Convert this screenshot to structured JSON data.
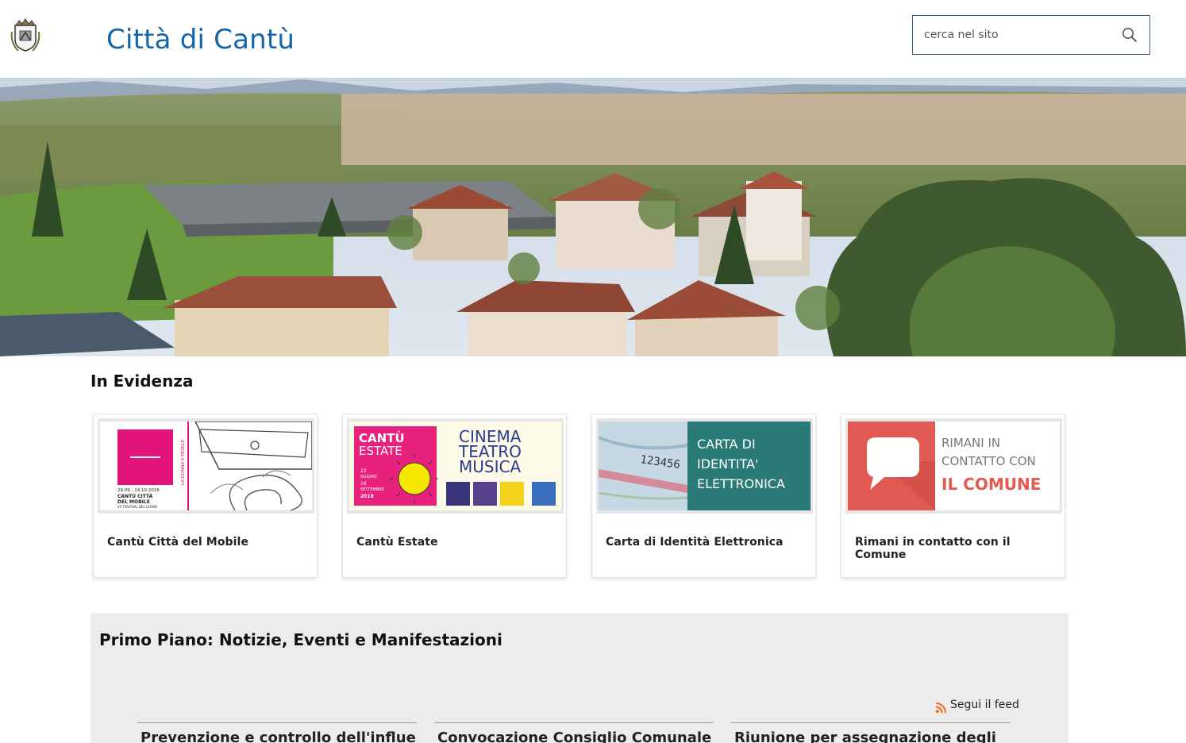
{
  "header": {
    "site_title": "Città di Cantù",
    "crest_icon": "municipal-crest-icon",
    "search": {
      "placeholder": "cerca nel sito",
      "value": "",
      "icon": "search-icon"
    }
  },
  "hero": {
    "image": "aerial-town-panorama"
  },
  "evidenza": {
    "title": "In Evidenza",
    "cards": [
      {
        "title": "Cantù Città del Mobile",
        "image": {
          "vertical_text": "LA DONNA E MOBILE",
          "dates": "29.09 - 14.10.2018",
          "line1": "CANTÙ CITTÀ",
          "line2": "DEL MOBILE",
          "line3": "VI° FESTIVAL DEL LEGNO"
        }
      },
      {
        "title": "Cantù Estate",
        "image": {
          "brand1": "CANTÙ",
          "brand2": "ESTATE",
          "date1": "22",
          "date2": "GIUGNO",
          "date3": "16",
          "date4": "SETTEMBRE",
          "year": "2018",
          "w1": "CINEMA",
          "w2": "TEATRO",
          "w3": "MUSICA"
        }
      },
      {
        "title": "Carta di Identità Elettronica",
        "image": {
          "l1": "CARTA DI",
          "l2": "IDENTITA'",
          "l3": "ELETTRONICA",
          "digits": "123456"
        }
      },
      {
        "title": "Rimani in contatto con il Comune",
        "image": {
          "l1": "RIMANI IN",
          "l2": "CONTATTO CON",
          "l3": "IL COMUNE",
          "icon": "speech-bubble-icon"
        }
      }
    ]
  },
  "primo_piano": {
    "title": "Primo Piano: Notizie, Eventi e Manifestazioni",
    "feed_label": "Segui il feed",
    "feed_icon": "rss-icon",
    "news": [
      {
        "title": "Prevenzione e controllo dell'influenza"
      },
      {
        "title": "Convocazione Consiglio Comunale"
      },
      {
        "title": "Riunione per assegnazione degli"
      }
    ]
  },
  "colors": {
    "brand_blue": "#1465a8",
    "search_border": "#3a5f86",
    "section_bg": "#ececec",
    "cie_teal": "#2a7a78",
    "comune_red": "#e35a52",
    "estate_pink": "#e8217c",
    "rss_orange": "#f26522"
  }
}
